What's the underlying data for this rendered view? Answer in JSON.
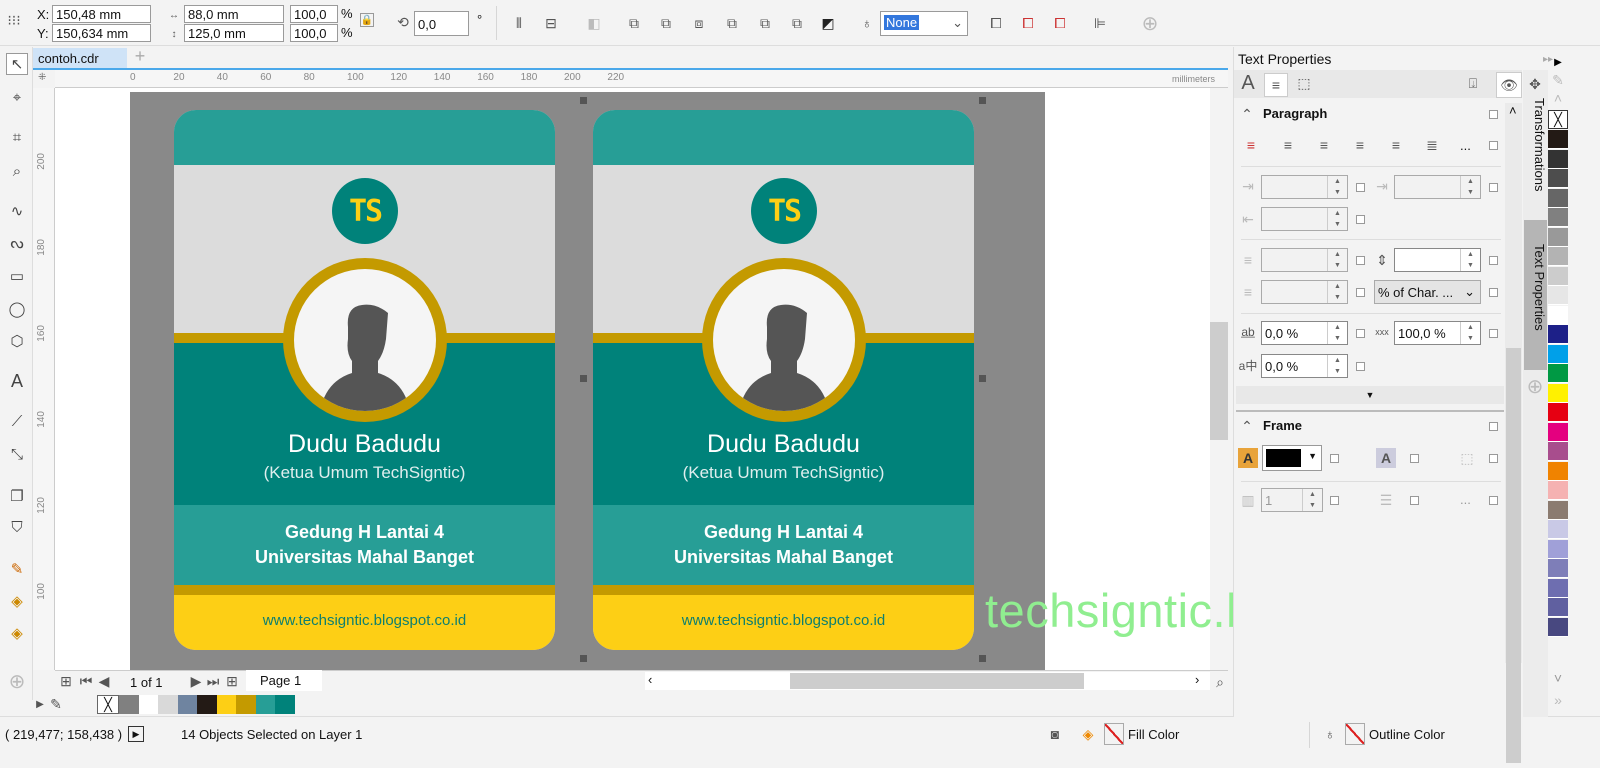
{
  "toolbar": {
    "x_label": "X:",
    "x_value": "150,48 mm",
    "y_label": "Y:",
    "y_value": "150,634 mm",
    "width_value": "88,0 mm",
    "height_value": "125,0 mm",
    "scale_x": "100,0",
    "scale_y": "100,0",
    "percent": "%",
    "rotation": "0,0",
    "degree": "°",
    "outline_style": "None"
  },
  "document": {
    "tab": "contoh.cdr",
    "add_tab": "+",
    "ruler_unit": "millimeters",
    "ruler_ticks": [
      "0",
      "20",
      "40",
      "60",
      "80",
      "100",
      "120",
      "140",
      "160",
      "180",
      "200",
      "220"
    ],
    "v_ruler_ticks": [
      "200",
      "180",
      "160",
      "140",
      "120",
      "100"
    ]
  },
  "cards": [
    {
      "name": "Dudu Badudu",
      "role": "(Ketua Umum TechSigntic)",
      "address1": "Gedung H Lantai 4",
      "address2": "Universitas Mahal Banget",
      "url": "www.techsigntic.blogspot.co.id",
      "logo": "TS"
    },
    {
      "name": "Dudu Badudu",
      "role": "(Ketua Umum TechSigntic)",
      "address1": "Gedung H Lantai 4",
      "address2": "Universitas Mahal Banget",
      "url": "www.techsigntic.blogspot.co.id",
      "logo": "TS"
    }
  ],
  "watermark": "techsigntic.blogspot.co.id",
  "pagenav": {
    "counter": "1 of 1",
    "page_tab": "Page 1"
  },
  "panel": {
    "title": "Text Properties",
    "paragraph": "Paragraph",
    "frame": "Frame",
    "line_spacing_unit": "% of Char. ...",
    "char_spacing": "0,0 %",
    "word_spacing": "100,0 %",
    "lang_spacing": "0,0 %",
    "columns": "1",
    "ellipsis": "...",
    "vtab1": "Transformations",
    "vtab2": "Text Properties"
  },
  "status": {
    "coords": "( 219,477; 158,438 )",
    "selection": "14 Objects Selected on Layer 1",
    "fill": "Fill Color",
    "outline": "Outline Color"
  },
  "colors": {
    "teal": "#279e96",
    "teal_dark": "#00827a",
    "gold": "#c49a00",
    "yellow": "#fdcf15",
    "gray": "#dcdcdc",
    "watermark": "#90ee90"
  },
  "doc_palette": [
    "#808080",
    "#ffffff",
    "#d9d9d9",
    "#6f84a0",
    "#231a15",
    "#fdcf15",
    "#c49a00",
    "#279e96",
    "#00827a"
  ],
  "palette": [
    "#231a15",
    "#333",
    "#4d4d4d",
    "#666",
    "#808080",
    "#999",
    "#b3b3b3",
    "#ccc",
    "#e6e6e6",
    "#fff",
    "#1d2088",
    "#00a0e9",
    "#009944",
    "#fff100",
    "#e60012",
    "#e4007f",
    "#a84d8d",
    "#f08300",
    "#f5b2b2",
    "#8b7b70",
    "#c9c9e6",
    "#a0a0d8",
    "#7e7eb8",
    "#6e6eb0",
    "#6060a0",
    "#484880"
  ]
}
